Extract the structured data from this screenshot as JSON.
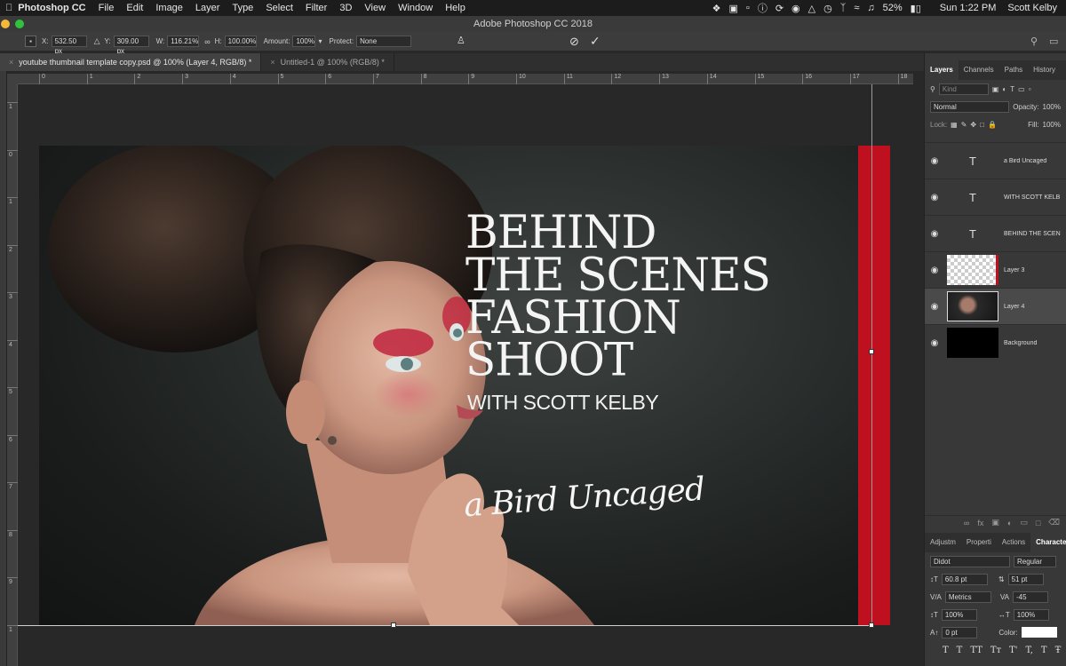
{
  "menubar": {
    "app": "Photoshop CC",
    "items": [
      "File",
      "Edit",
      "Image",
      "Layer",
      "Type",
      "Select",
      "Filter",
      "3D",
      "View",
      "Window",
      "Help"
    ],
    "battery": "52%",
    "time": "Sun 1:22 PM",
    "user": "Scott Kelby"
  },
  "titlebar": {
    "title": "Adobe Photoshop CC 2018"
  },
  "options": {
    "x_label": "X:",
    "x_value": "532.50 px",
    "y_label": "Y:",
    "y_value": "309.00 px",
    "w_label": "W:",
    "w_value": "116.21%",
    "h_label": "H:",
    "h_value": "100.00%",
    "amount_label": "Amount:",
    "amount_value": "100%",
    "protect_label": "Protect:",
    "protect_value": "None"
  },
  "tabs": [
    {
      "label": "youtube thumbnail template copy.psd @ 100% (Layer 4, RGB/8) *"
    },
    {
      "label": "Untitled-1 @ 100% (RGB/8) *"
    }
  ],
  "ruler_h": [
    "0",
    "1",
    "2",
    "3",
    "4",
    "5",
    "6",
    "7",
    "8",
    "9",
    "10",
    "11",
    "12",
    "13",
    "14",
    "15",
    "16",
    "17",
    "18"
  ],
  "ruler_v": [
    "1",
    "0",
    "1",
    "2",
    "3",
    "4",
    "5",
    "6",
    "7",
    "8",
    "9",
    "1"
  ],
  "artwork": {
    "title_lines": [
      "BEHIND",
      "THE SCENES",
      "FASHION",
      "SHOOT"
    ],
    "subtitle": "WITH SCOTT KELBY",
    "script": "a Bird Uncaged",
    "accent_color": "#bf1020"
  },
  "panel": {
    "tabs": [
      "Layers",
      "Channels",
      "Paths",
      "History"
    ],
    "kind_placeholder": "Kind",
    "blend_mode": "Normal",
    "opacity_label": "Opacity:",
    "opacity_value": "100%",
    "lock_label": "Lock:",
    "fill_label": "Fill:",
    "fill_value": "100%",
    "layers": [
      {
        "name": "a Bird Uncaged",
        "type": "text"
      },
      {
        "name": "WITH SCOTT KELB",
        "type": "text"
      },
      {
        "name": "BEHIND  THE SCEN",
        "type": "text"
      },
      {
        "name": "Layer 3",
        "type": "checker"
      },
      {
        "name": "Layer 4",
        "type": "photo"
      },
      {
        "name": "Background",
        "type": "black"
      }
    ],
    "char_tabs": [
      "Adjustm",
      "Properti",
      "Actions",
      "Character"
    ],
    "font_family": "Didot",
    "font_style": "Regular",
    "font_size": "60.8 pt",
    "leading": "51 pt",
    "kerning": "Metrics",
    "tracking": "-45",
    "vscale": "100%",
    "hscale": "100%",
    "baseline": "0 pt",
    "color_label": "Color:",
    "type_buttons": [
      "T",
      "T",
      "TT",
      "Tт",
      "T'",
      "T,",
      "T",
      "Ŧ"
    ]
  }
}
